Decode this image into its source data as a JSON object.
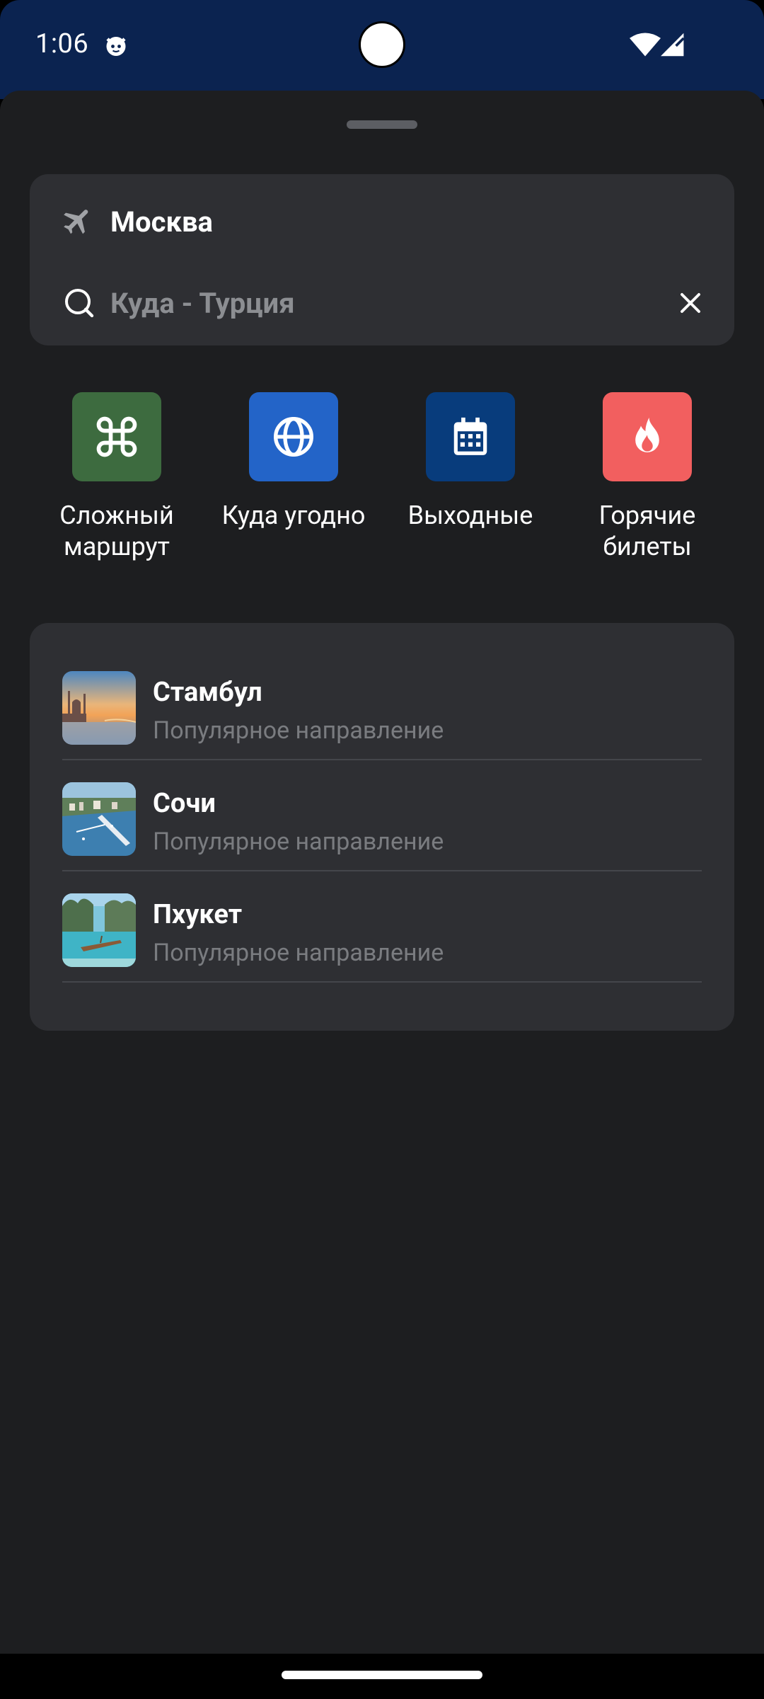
{
  "status_bar": {
    "time": "1:06",
    "notification_icon": "cat-face-icon",
    "wifi_icon": "wifi-icon",
    "signal_icon": "signal-icon"
  },
  "search": {
    "from_icon": "airplane-icon",
    "from_city": "Москва",
    "to_icon": "search-icon",
    "to_value": "Куда - Турция",
    "clear_icon": "close-icon"
  },
  "quick_actions": [
    {
      "label": "Сложный\nмаршрут",
      "icon": "command-icon",
      "color": "#3d6b3f"
    },
    {
      "label": "Куда угодно",
      "icon": "globe-icon",
      "color": "#2364c8"
    },
    {
      "label": "Выходные",
      "icon": "calendar-icon",
      "color": "#083c7c"
    },
    {
      "label": "Горячие\nбилеты",
      "icon": "flame-icon",
      "color": "#f25f5f"
    }
  ],
  "destinations": [
    {
      "title": "Стамбул",
      "subtitle": "Популярное направление",
      "image": "istanbul-photo"
    },
    {
      "title": "Сочи",
      "subtitle": "Популярное направление",
      "image": "sochi-photo"
    },
    {
      "title": "Пхукет",
      "subtitle": "Популярное направление",
      "image": "phuket-photo"
    }
  ],
  "colors": {
    "status_bar": "#0b2350",
    "sheet_bg": "#1d1e20",
    "card_bg": "#2e2f33",
    "subtitle": "#7a7c80"
  }
}
